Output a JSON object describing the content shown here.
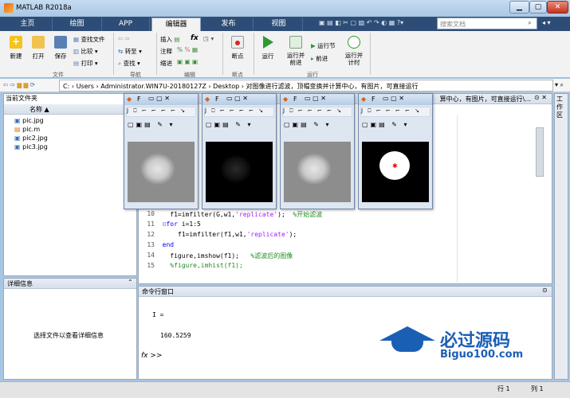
{
  "window": {
    "title": "MATLAB R2018a"
  },
  "tabs": [
    "主页",
    "绘图",
    "APP",
    "编辑器",
    "发布",
    "视图"
  ],
  "active_tab": "编辑器",
  "search": {
    "placeholder": "搜索文档"
  },
  "ribbon": {
    "file": {
      "new": "新建",
      "open": "打开",
      "save": "保存",
      "find_files": "查找文件",
      "compare": "比较",
      "print": "打印",
      "group": "文件"
    },
    "nav": {
      "goto": "转至",
      "find": "查找",
      "group": "导航"
    },
    "edit": {
      "insert": "插入",
      "fx": "fx",
      "comment": "注释",
      "indent": "缩进",
      "group": "编辑"
    },
    "breakpoints": {
      "label": "断点",
      "group": "断点"
    },
    "run": {
      "run": "运行",
      "run_advance": "运行并\n前进",
      "run_section": "运行节",
      "advance": "前进",
      "run_time": "运行并\n计时",
      "group": "运行"
    }
  },
  "address": {
    "path": "C: › Users › Administrator.WIN7U-20180127Z › Desktop › 对图像进行滤波，顶帽变换并计算中心，有图片，可直接运行"
  },
  "current_folder": {
    "title": "当前文件夹",
    "column": "名称 ▲",
    "files": [
      "pic.jpg",
      "pic.m",
      "pic2.jpg",
      "pic3.jpg"
    ]
  },
  "details": {
    "title": "详细信息",
    "message": "选择文件以查看详细信息"
  },
  "editor": {
    "header_tail": "算中心，有图片，可直接运行\\...",
    "lines": [
      {
        "num": "10",
        "code": "    f1=imfilter(G,w1,'replicate');  %开始滤波"
      },
      {
        "num": "11",
        "code": "  for i=1:5"
      },
      {
        "num": "12",
        "code": "      f1=imfilter(f1,w1,'replicate');"
      },
      {
        "num": "13",
        "code": "  end"
      },
      {
        "num": "14",
        "code": "    figure,imshow(f1);   %滤波后的图像"
      },
      {
        "num": "15",
        "code": "    %figure,imhist(f1);"
      }
    ]
  },
  "command_window": {
    "title": "命令行窗口",
    "output_name": "I =",
    "output_value": "160.5259",
    "prompt": "fx >>"
  },
  "right_sidebar": {
    "label": "工作区"
  },
  "status": {
    "line_label": "行",
    "line_value": "1",
    "col_label": "列",
    "col_value": "1"
  },
  "watermark": {
    "title": "必过源码",
    "url": "Biguo100.com"
  },
  "figures": [
    {
      "title": "F",
      "style": "gray-blur"
    },
    {
      "title": "F",
      "style": "tophat-dark"
    },
    {
      "title": "F",
      "style": "gray-blur"
    },
    {
      "title": "F",
      "style": "binary-center"
    }
  ]
}
